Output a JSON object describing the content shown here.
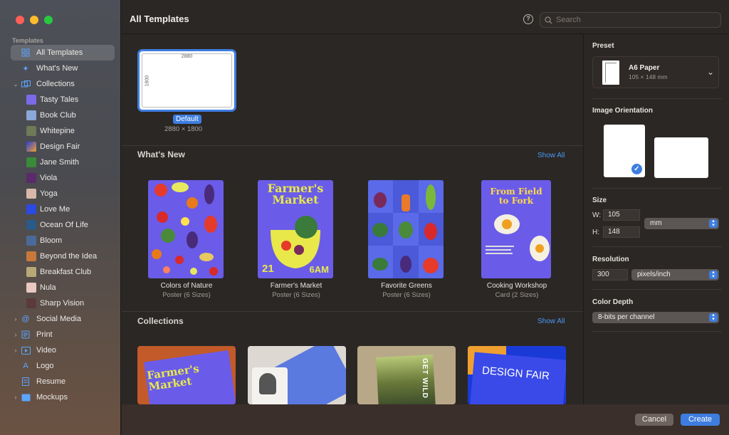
{
  "window": {
    "title": "All Templates"
  },
  "search": {
    "placeholder": "Search"
  },
  "sidebar": {
    "header": "Templates",
    "items": [
      {
        "label": "All Templates",
        "icon": "grid-icon"
      },
      {
        "label": "What's New",
        "icon": "sparkle-icon"
      },
      {
        "label": "Collections",
        "icon": "collections-icon"
      },
      {
        "label": "Tasty Tales"
      },
      {
        "label": "Book Club"
      },
      {
        "label": "Whitepine"
      },
      {
        "label": "Design Fair"
      },
      {
        "label": "Jane Smith"
      },
      {
        "label": "Viola"
      },
      {
        "label": "Yoga"
      },
      {
        "label": "Love Me"
      },
      {
        "label": "Ocean Of Life"
      },
      {
        "label": "Bloom"
      },
      {
        "label": "Beyond the Idea"
      },
      {
        "label": "Breakfast Club"
      },
      {
        "label": "Nula"
      },
      {
        "label": "Sharp Vision"
      },
      {
        "label": "Social Media",
        "icon": "at-icon"
      },
      {
        "label": "Print",
        "icon": "print-icon"
      },
      {
        "label": "Video",
        "icon": "video-icon"
      },
      {
        "label": "Logo",
        "icon": "logo-icon"
      },
      {
        "label": "Resume",
        "icon": "resume-icon"
      },
      {
        "label": "Mockups",
        "icon": "mockups-icon"
      }
    ]
  },
  "default_template": {
    "label": "Default",
    "size": "2880 × 1800",
    "width_label": "2880",
    "height_label": "1800"
  },
  "whats_new": {
    "title": "What's New",
    "show_all": "Show All",
    "templates": [
      {
        "name": "Colors of Nature",
        "sub": "Poster (6 Sizes)"
      },
      {
        "name": "Farmer's Market",
        "sub": "Poster (6 Sizes)",
        "art_title": "Farmer's Market",
        "art_date": "21",
        "art_time": "6AM"
      },
      {
        "name": "Favorite Greens",
        "sub": "Poster (6 Sizes)"
      },
      {
        "name": "Cooking Workshop",
        "sub": "Card (2 Sizes)",
        "art_title": "From Field to Fork"
      }
    ]
  },
  "collections": {
    "title": "Collections",
    "show_all": "Show All",
    "items": [
      {
        "art_title": "Farmer's Market"
      },
      {
        "art_title": ""
      },
      {
        "art_title": "GET WILD"
      },
      {
        "art_title": "DESIGN FAIR"
      }
    ]
  },
  "inspector": {
    "preset": {
      "label": "Preset",
      "name": "A6 Paper",
      "dims": "105 × 148 mm"
    },
    "orientation": {
      "label": "Image Orientation"
    },
    "size": {
      "label": "Size",
      "w_label": "W:",
      "w": "105",
      "h_label": "H:",
      "h": "148",
      "unit": "mm"
    },
    "resolution": {
      "label": "Resolution",
      "value": "300",
      "unit": "pixels/inch"
    },
    "color_depth": {
      "label": "Color Depth",
      "value": "8-bits per channel"
    }
  },
  "buttons": {
    "cancel": "Cancel",
    "create": "Create"
  },
  "colors": {
    "accent": "#3e7de0",
    "link": "#4a9af8",
    "poster_purple": "#6b5ce7",
    "poster_yellow": "#e8e84a"
  }
}
